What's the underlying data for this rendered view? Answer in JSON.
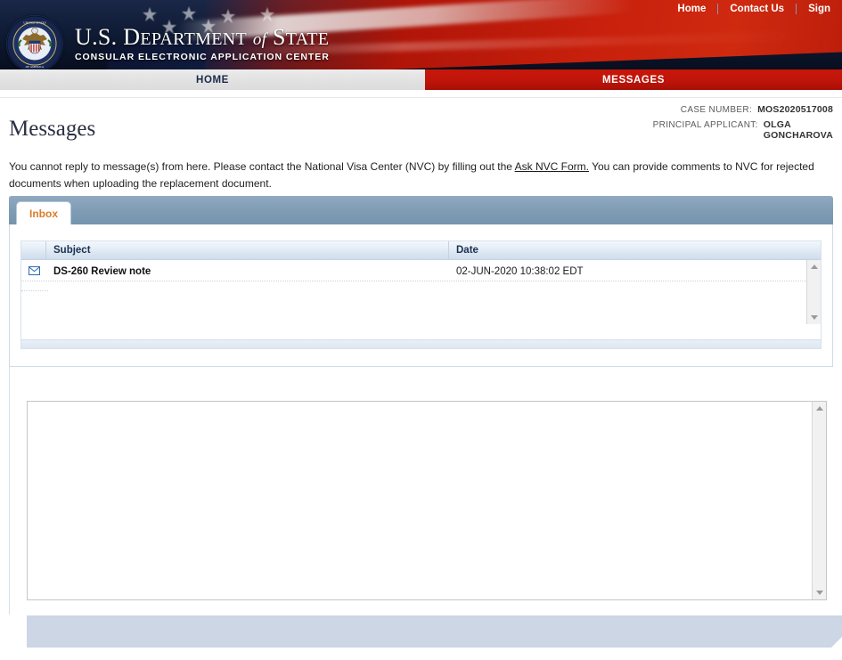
{
  "header": {
    "topnav": [
      {
        "label": "Home",
        "name": "topnav-home"
      },
      {
        "label": "Contact Us",
        "name": "topnav-contact-us"
      },
      {
        "label": "Sign",
        "name": "topnav-sign-out"
      }
    ],
    "brand_title_part1": "U.S. D",
    "brand_title_part2": "EPARTMENT",
    "brand_title_part3": "of",
    "brand_title_part4": "S",
    "brand_title_part5": "TATE",
    "brand_subtitle": "CONSULAR ELECTRONIC APPLICATION CENTER",
    "seal_alt": "department-of-state-seal"
  },
  "mainnav": {
    "home": "HOME",
    "messages": "MESSAGES",
    "active": "MESSAGES"
  },
  "case": {
    "case_number_label": "CASE NUMBER:",
    "case_number_value": "MOS2020517008",
    "principal_applicant_label": "PRINCIPAL APPLICANT:",
    "principal_applicant_line1": "OLGA",
    "principal_applicant_line2": "GONCHAROVA"
  },
  "page": {
    "title": "Messages",
    "intro_part1": "You cannot reply to message(s) from here.  Please contact the National Visa Center (NVC) by filling out the ",
    "intro_link": "Ask NVC Form.",
    "intro_part2": "  You can provide comments to NVC for rejected documents when uploading the replacement document."
  },
  "tabs": [
    {
      "label": "Inbox",
      "name": "tab-inbox",
      "active": true
    }
  ],
  "grid": {
    "columns": [
      {
        "key": "icon",
        "label": ""
      },
      {
        "key": "subject",
        "label": "Subject"
      },
      {
        "key": "date",
        "label": "Date"
      }
    ],
    "rows": [
      {
        "icon": "envelope-icon",
        "subject": "DS-260 Review note",
        "date": "02-JUN-2020 10:38:02 EDT"
      }
    ]
  },
  "detail": {
    "body": ""
  },
  "scrollbars": {
    "up_arrow": "scroll-up-arrow",
    "down_arrow": "scroll-down-arrow"
  },
  "colors": {
    "brand_red": "#c2150a",
    "brand_navy": "#101c36",
    "tab_accent": "#d97d29",
    "grid_header": "#cfdced",
    "footer": "#ccd6e5"
  }
}
